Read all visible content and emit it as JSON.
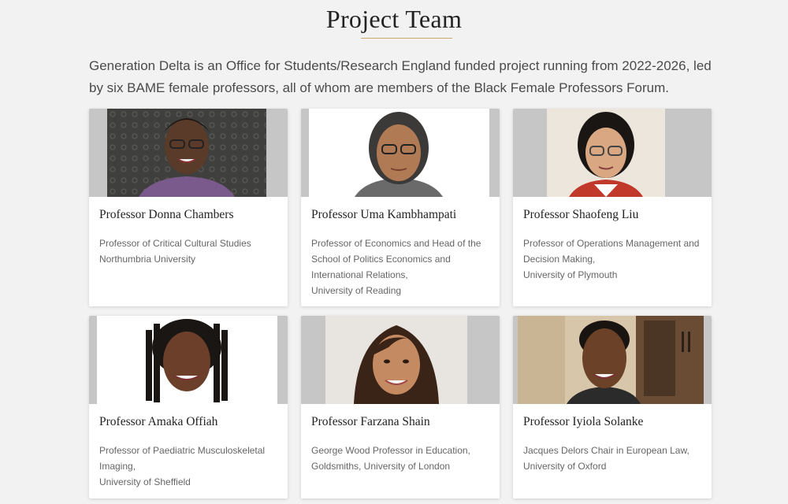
{
  "page": {
    "title": "Project Team",
    "intro": "Generation Delta is an Office for Students/Research England funded project running from 2022-2026, led by six BAME female professors, all of whom are members of the Black Female Professors Forum."
  },
  "colors": {
    "accent": "#c8a96a",
    "band": "#c6c6c6",
    "card": "#ffffff",
    "page": "#f2f2f2"
  },
  "team": [
    {
      "name": "Professor Donna Chambers",
      "lines": [
        "Professor of Critical Cultural Studies",
        "Northumbria University"
      ]
    },
    {
      "name": "Professor Uma Kambhampati",
      "lines": [
        "Professor of Economics and Head of the",
        "School of Politics Economics and",
        "International Relations,",
        "University of Reading"
      ]
    },
    {
      "name": "Professor Shaofeng Liu",
      "lines": [
        "Professor of Operations Management and",
        "Decision Making,",
        "University of Plymouth"
      ]
    },
    {
      "name": "Professor Amaka Offiah",
      "lines": [
        "Professor of Paediatric Musculoskeletal",
        "Imaging,",
        "University of Sheffield"
      ]
    },
    {
      "name": "Professor Farzana Shain",
      "lines": [
        "George Wood Professor in Education,",
        "Goldsmiths, University of London"
      ]
    },
    {
      "name": "Professor Iyiola Solanke",
      "lines": [
        "Jacques Delors Chair in European Law,",
        "University of Oxford"
      ]
    }
  ]
}
